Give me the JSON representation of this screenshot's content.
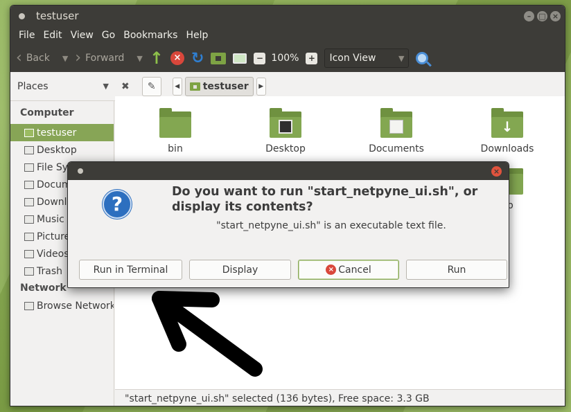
{
  "window": {
    "title": "testuser"
  },
  "menubar": [
    "File",
    "Edit",
    "View",
    "Go",
    "Bookmarks",
    "Help"
  ],
  "toolbar": {
    "back_label": "Back",
    "forward_label": "Forward",
    "zoom": "100%",
    "view_mode": "Icon View"
  },
  "locbar": {
    "places_label": "Places",
    "crumb": "testuser"
  },
  "sidebar": {
    "computer_header": "Computer",
    "items": [
      {
        "label": "testuser",
        "icon": "home-folder-icon",
        "selected": true
      },
      {
        "label": "Desktop",
        "icon": "desktop-icon"
      },
      {
        "label": "File System",
        "icon": "drive-icon"
      },
      {
        "label": "Documents",
        "icon": "documents-icon"
      },
      {
        "label": "Downloads",
        "icon": "downloads-icon"
      },
      {
        "label": "Music",
        "icon": "music-icon"
      },
      {
        "label": "Pictures",
        "icon": "pictures-icon"
      },
      {
        "label": "Videos",
        "icon": "videos-icon"
      },
      {
        "label": "Trash",
        "icon": "trash-icon"
      }
    ],
    "network_header": "Network",
    "network_items": [
      {
        "label": "Browse Network",
        "icon": "network-icon"
      }
    ]
  },
  "files": [
    {
      "name": "bin",
      "icon": "folder-icon"
    },
    {
      "name": "Desktop",
      "icon": "desktop-folder-icon"
    },
    {
      "name": "Documents",
      "icon": "documents-folder-icon"
    },
    {
      "name": "Downloads",
      "icon": "downloads-folder-icon"
    },
    {
      "name": "ap",
      "icon": "folder-icon"
    }
  ],
  "status": "\"start_netpyne_ui.sh\" selected (136 bytes), Free space: 3.3 GB",
  "dialog": {
    "heading": "Do you want to run \"start_netpyne_ui.sh\", or display its contents?",
    "subtext": "\"start_netpyne_ui.sh\" is an executable text file.",
    "buttons": {
      "run_in_terminal": "Run in Terminal",
      "display": "Display",
      "cancel": "Cancel",
      "run": "Run"
    }
  },
  "colors": {
    "accent": "#87a556",
    "titlebar": "#3d3c38",
    "danger": "#d9473b"
  }
}
